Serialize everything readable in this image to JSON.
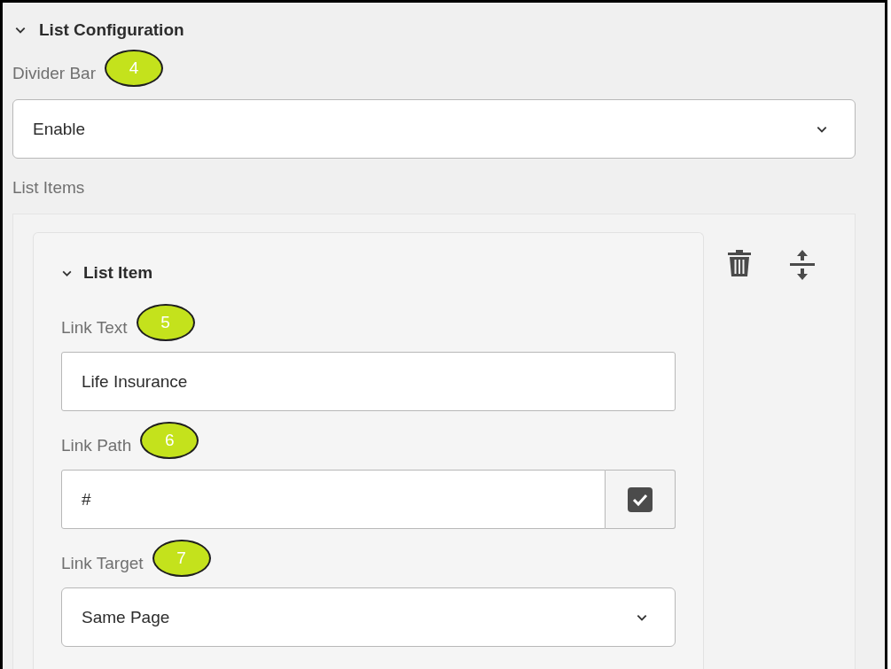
{
  "section": {
    "title": "List Configuration",
    "expanded": true
  },
  "divider_bar": {
    "label": "Divider Bar",
    "badge": "4",
    "value": "Enable"
  },
  "list_items": {
    "label": "List Items",
    "items": [
      {
        "title": "List Item",
        "expanded": true,
        "fields": [
          {
            "kind": "text",
            "label": "Link Text",
            "badge": "5",
            "value": "Life Insurance"
          },
          {
            "kind": "path",
            "label": "Link Path",
            "badge": "6",
            "value": "#"
          },
          {
            "kind": "select",
            "label": "Link Target",
            "badge": "7",
            "value": "Same Page"
          }
        ]
      }
    ]
  }
}
